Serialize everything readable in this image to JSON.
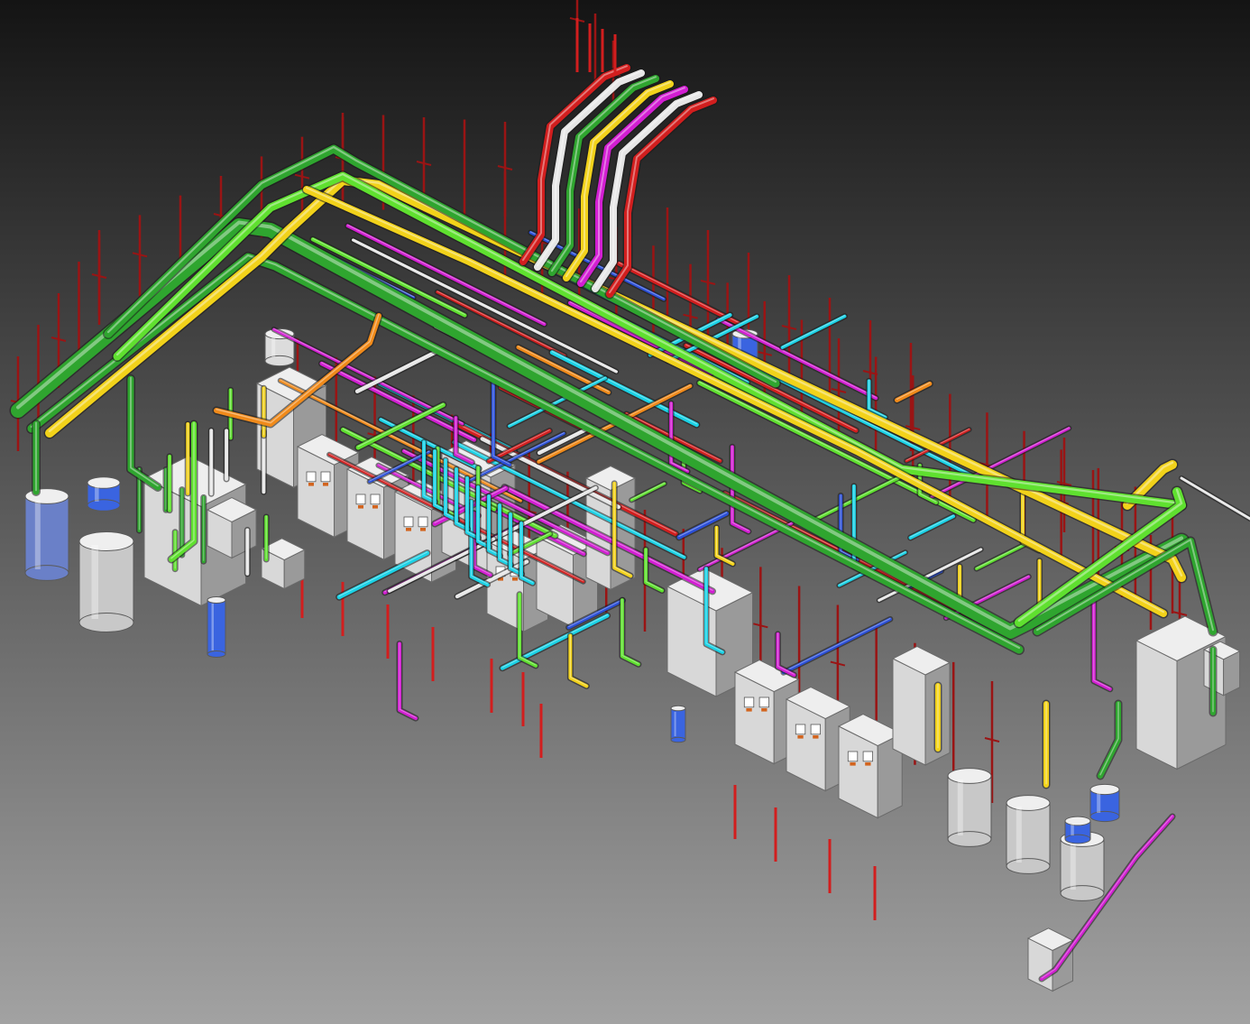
{
  "scene": {
    "subject": "isometric-piping-plant-render",
    "background": {
      "top": "#141414",
      "bottom": "#a2a2a2"
    },
    "pipe_colors": {
      "green": "#2fa52f",
      "lime": "#5fe02f",
      "yellow": "#f2d21a",
      "orange": "#f08a1a",
      "magenta": "#d21ed2",
      "cyan": "#1ad2e6",
      "blue": "#2b4fd8",
      "red": "#d21e1e",
      "white": "#e6e6e6",
      "support": "#9a1414"
    },
    "equipment_colors": {
      "cabinet": "#d8d8d8",
      "cabinet_shade": "#9a9a9a",
      "tank": "#c8c8c8",
      "tank_blue": "#6a80c8",
      "pump_blue": "#3a64e0"
    }
  }
}
